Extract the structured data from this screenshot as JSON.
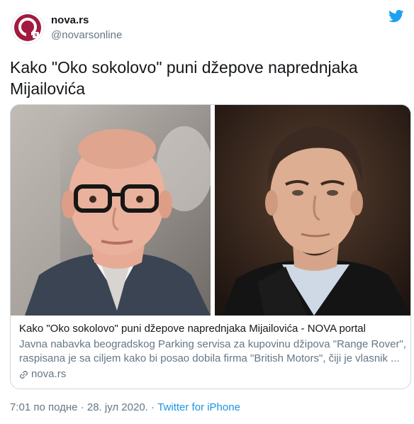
{
  "author": {
    "display_name": "nova.rs",
    "handle": "@novarsonline",
    "avatar_icon": "nova-logo-icon"
  },
  "tweet": {
    "text_line1": "Kako \"Oko sokolovo\" puni džepove naprednjaka",
    "text_line2": "Mijailovića"
  },
  "card": {
    "title": "Kako \"Oko sokolovo\" puni džepove naprednjaka Mijailovića - NOVA portal",
    "desc_line1": "Javna nabavka beogradskog Parking servisa za kupovinu džipova \"Range Rover\",",
    "desc_line2": "raspisana je sa ciljem kako bi posao dobila firma \"British Motors\", čiji je vlasnik ...",
    "domain": "nova.rs",
    "domain_icon": "link-icon"
  },
  "meta": {
    "time": "7:01 по подне",
    "separator1": " · ",
    "date": "28. јул 2020.",
    "separator2": " · ",
    "source": "Twitter for iPhone"
  },
  "colors": {
    "brand": "#a31a3f",
    "link": "#1b95e0",
    "secondary_text": "#657786",
    "border": "#ccd6dd"
  }
}
